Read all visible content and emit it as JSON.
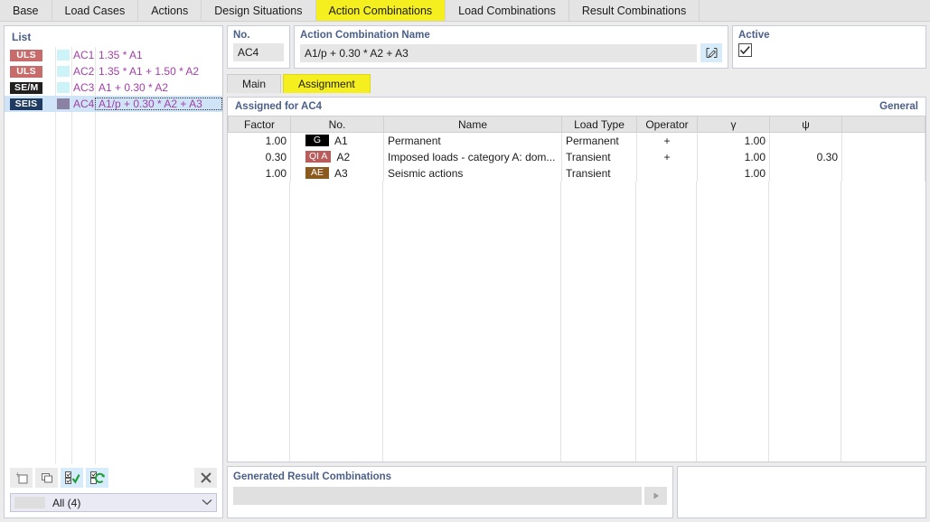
{
  "tabs": [
    {
      "label": "Base",
      "active": false
    },
    {
      "label": "Load Cases",
      "active": false
    },
    {
      "label": "Actions",
      "active": false
    },
    {
      "label": "Design Situations",
      "active": false
    },
    {
      "label": "Action Combinations",
      "active": true
    },
    {
      "label": "Load Combinations",
      "active": false
    },
    {
      "label": "Result Combinations",
      "active": false
    }
  ],
  "sidebar": {
    "title": "List",
    "rows": [
      {
        "badge": "ULS",
        "badge_color": "#c86b6b",
        "swatch": "#ccf4f8",
        "no": "AC1",
        "formula": "1.35 * A1",
        "selected": false
      },
      {
        "badge": "ULS",
        "badge_color": "#c86b6b",
        "swatch": "#ccf4f8",
        "no": "AC2",
        "formula": "1.35 * A1 + 1.50 * A2",
        "selected": false
      },
      {
        "badge": "SE/M",
        "badge_color": "#221f1f",
        "swatch": "#ccf4f8",
        "no": "AC3",
        "formula": "A1 + 0.30 * A2",
        "selected": false
      },
      {
        "badge": "SEIS",
        "badge_color": "#1f3b61",
        "swatch": "#8b82a3",
        "no": "AC4",
        "formula": "A1/p + 0.30 * A2 + A3",
        "selected": true
      }
    ],
    "toolbar": [
      {
        "name": "new-combination-button",
        "icon": "new-icon",
        "style": "plain"
      },
      {
        "name": "copy-combination-button",
        "icon": "copy-icon",
        "style": "plain"
      },
      {
        "name": "select-all-button",
        "icon": "check-all-icon",
        "style": "blue"
      },
      {
        "name": "invert-selection-button",
        "icon": "toggle-check-icon",
        "style": "blue"
      },
      {
        "name": "delete-combination-button",
        "icon": "close-icon",
        "style": "plain"
      }
    ],
    "filter": {
      "label": "All (4)",
      "caret": "⌄"
    }
  },
  "fields": {
    "no": {
      "label": "No.",
      "value": "AC4"
    },
    "name": {
      "label": "Action Combination Name",
      "value": "A1/p + 0.30 * A2 + A3"
    },
    "active": {
      "label": "Active",
      "checked": true
    }
  },
  "subtabs": [
    {
      "label": "Main",
      "active": false
    },
    {
      "label": "Assignment",
      "active": true
    }
  ],
  "panel": {
    "title": "Assigned for AC4",
    "general_label": "General",
    "columns": [
      "Factor",
      "No.",
      "Name",
      "Load Type",
      "Operator",
      "γ",
      "ψ",
      ""
    ],
    "rows": [
      {
        "factor": "1.00",
        "badge": "G",
        "badge_color": "#000000",
        "no": "A1",
        "name": "Permanent",
        "load_type": "Permanent",
        "operator": "+",
        "gamma": "1.00",
        "psi": ""
      },
      {
        "factor": "0.30",
        "badge": "QI A",
        "badge_color": "#b85c5c",
        "no": "A2",
        "name": "Imposed loads - category A: dom...",
        "load_type": "Transient",
        "operator": "+",
        "gamma": "1.00",
        "psi": "0.30"
      },
      {
        "factor": "1.00",
        "badge": "AE",
        "badge_color": "#8b5a1e",
        "no": "A3",
        "name": "Seismic actions",
        "load_type": "Transient",
        "operator": "",
        "gamma": "1.00",
        "psi": ""
      }
    ]
  },
  "generated": {
    "label": "Generated Result Combinations",
    "value": "",
    "run_icon": "play-icon"
  },
  "colors": {
    "accent_yellow": "#f5ef20",
    "header_blue": "#4a5f89",
    "selection_blue": "#cfe4f7",
    "magenta_text": "#a23fa8"
  }
}
